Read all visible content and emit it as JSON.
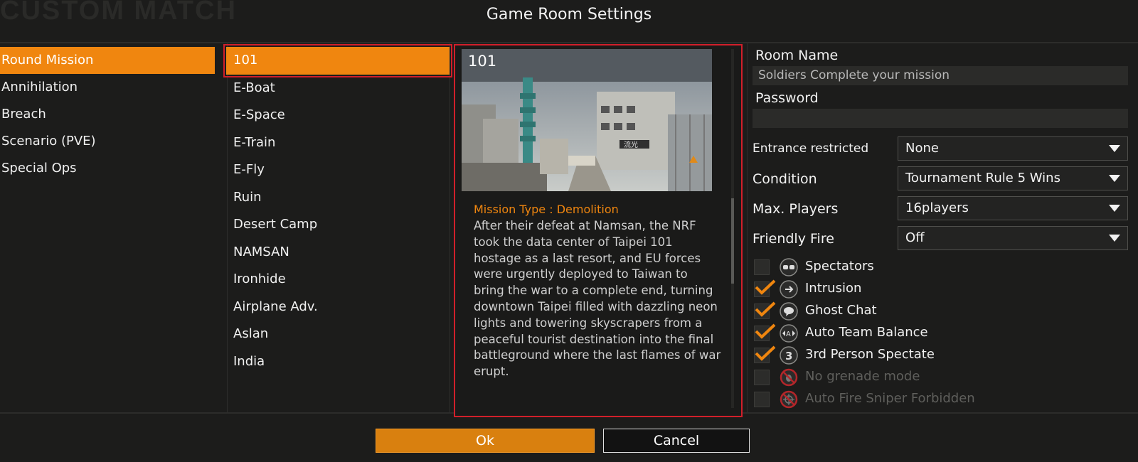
{
  "background_title": "CUSTOM MATCH",
  "dialog_title": "Game Room Settings",
  "colors": {
    "accent": "#f0860f",
    "selection_outline": "#d11f2a",
    "panel": "#1c1c1b"
  },
  "modes": [
    {
      "label": "Round Mission",
      "selected": true
    },
    {
      "label": "Annihilation",
      "selected": false
    },
    {
      "label": "Breach",
      "selected": false
    },
    {
      "label": "Scenario (PVE)",
      "selected": false
    },
    {
      "label": "Special Ops",
      "selected": false
    }
  ],
  "maps": [
    {
      "label": "101",
      "selected": true
    },
    {
      "label": "E-Boat",
      "selected": false
    },
    {
      "label": "E-Space",
      "selected": false
    },
    {
      "label": "E-Train",
      "selected": false
    },
    {
      "label": "E-Fly",
      "selected": false
    },
    {
      "label": "Ruin",
      "selected": false
    },
    {
      "label": "Desert Camp",
      "selected": false
    },
    {
      "label": "NAMSAN",
      "selected": false
    },
    {
      "label": "Ironhide",
      "selected": false
    },
    {
      "label": "Airplane Adv.",
      "selected": false
    },
    {
      "label": "Aslan",
      "selected": false
    },
    {
      "label": "India",
      "selected": false
    }
  ],
  "preview": {
    "map_title": "101",
    "mission_type": "Mission Type : Demolition",
    "description": "After their defeat at Namsan, the NRF took the data center of Taipei 101 hostage as a last resort, and EU forces were urgently deployed to Taiwan to bring the war to a complete end, turning downtown Taipei filled with dazzling neon lights and towering skyscrapers from a peaceful tourist destination into the final battleground where the last flames of war erupt.",
    "sign_text": "流光"
  },
  "settings": {
    "room_name_label": "Room Name",
    "room_name_value": "Soldiers Complete your mission",
    "password_label": "Password",
    "password_value": "",
    "entrance_label": "Entrance restricted",
    "entrance_value": "None",
    "condition_label": "Condition",
    "condition_value": "Tournament Rule 5 Wins",
    "max_players_label": "Max. Players",
    "max_players_value": "16players",
    "friendly_fire_label": "Friendly Fire",
    "friendly_fire_value": "Off"
  },
  "options": [
    {
      "label": "Spectators",
      "checked": false,
      "enabled": true,
      "icon": "spectator-goggles-icon"
    },
    {
      "label": "Intrusion",
      "checked": true,
      "enabled": true,
      "icon": "intrusion-arrow-icon"
    },
    {
      "label": "Ghost Chat",
      "checked": true,
      "enabled": true,
      "icon": "chat-bubble-icon"
    },
    {
      "label": "Auto Team Balance",
      "checked": true,
      "enabled": true,
      "icon": "team-balance-icon"
    },
    {
      "label": "3rd Person Spectate",
      "checked": true,
      "enabled": true,
      "icon": "third-person-icon"
    },
    {
      "label": "No grenade mode",
      "checked": false,
      "enabled": false,
      "icon": "no-grenade-icon"
    },
    {
      "label": "Auto Fire Sniper Forbidden",
      "checked": false,
      "enabled": false,
      "icon": "no-sniper-icon"
    }
  ],
  "buttons": {
    "ok": "Ok",
    "cancel": "Cancel"
  }
}
